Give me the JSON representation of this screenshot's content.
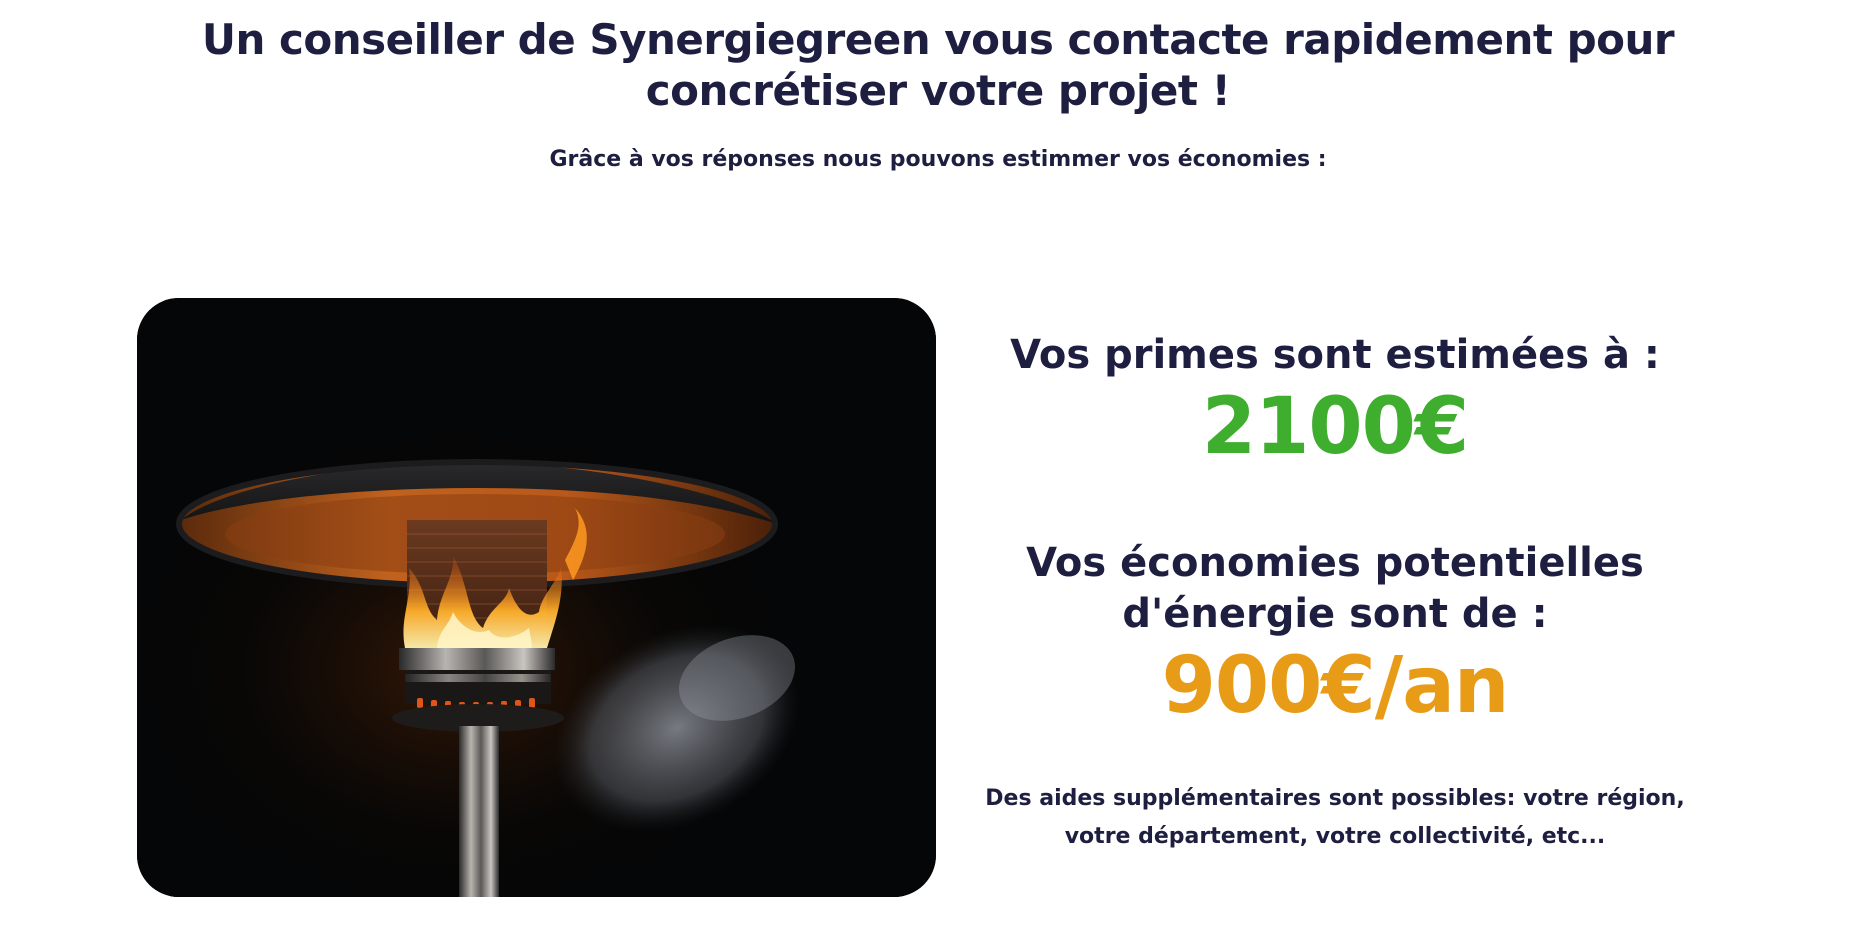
{
  "header": {
    "title": "Un conseiller de Synergiegreen vous contacte rapidement pour concrétiser votre projet !",
    "subtitle": "Grâce à vos réponses nous pouvons estimmer vos économies :"
  },
  "image": {
    "icon": "patio-heater-flame-photo"
  },
  "results": {
    "primes_label": "Vos primes sont estimées à :",
    "primes_value": "2100€",
    "economies_label": "Vos économies potentielles d'énergie sont de :",
    "economies_value": "900€/an",
    "aides_text": "Des aides supplémentaires sont possibles: votre région, votre département, votre collectivité, etc..."
  },
  "colors": {
    "text": "#1e1e40",
    "primes": "#3fae2f",
    "economies": "#e89b16"
  }
}
